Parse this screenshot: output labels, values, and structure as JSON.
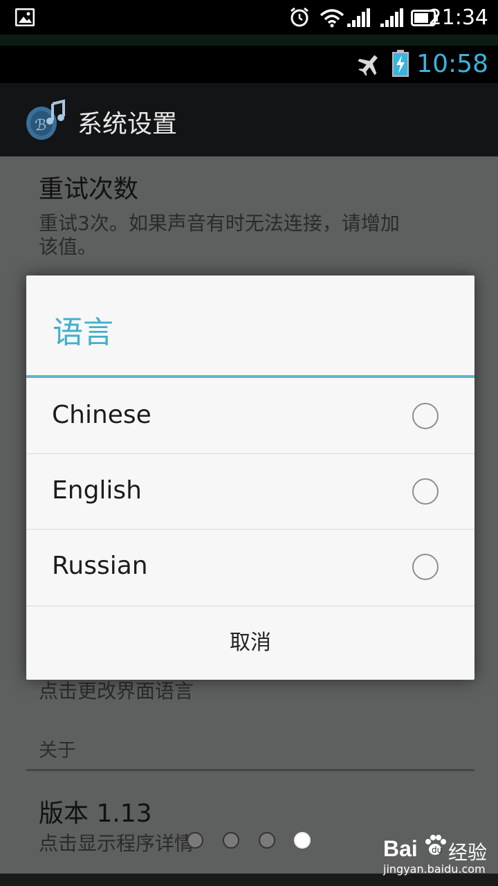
{
  "outer_status": {
    "time": "21:34"
  },
  "inner_status": {
    "time": "10:58"
  },
  "app_bar": {
    "title": "系统设置"
  },
  "settings": {
    "retry": {
      "title": "重试次数",
      "summary_line1": "重试3次。如果声音有时无法连接，请增加",
      "summary_line2": "该值。"
    },
    "language_summary": "点击更改界面语言",
    "about_header": "关于",
    "version": {
      "title": "版本 1.13",
      "summary": "点击显示程序详情"
    }
  },
  "dialog": {
    "title": "语言",
    "options": [
      {
        "label": "Chinese",
        "selected": false
      },
      {
        "label": "English",
        "selected": false
      },
      {
        "label": "Russian",
        "selected": false
      }
    ],
    "cancel_label": "取消"
  },
  "page_indicator": {
    "count": 4,
    "active_index": 3
  },
  "watermark": {
    "brand": "Bai",
    "brand2": "经验",
    "url": "jingyan.baidu.com"
  },
  "colors": {
    "accent": "#43afcb",
    "clock_blue": "#3ab3e0"
  }
}
